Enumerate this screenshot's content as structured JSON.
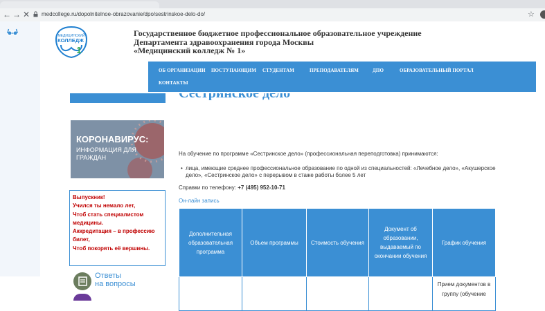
{
  "browser": {
    "url": "medcollege.ru/dopolnitelnoe-obrazovanie/dpo/sestrinskoe-delo-do/"
  },
  "header": {
    "logo_lines": [
      "МЕДИЦИНСКИЙ",
      "КОЛЛЕДЖ",
      "1"
    ],
    "institution": [
      "Государственное бюджетное профессиональное образовательное учреждение",
      "Департамента здравоохранения города Москвы",
      "«Медицинский колледж № 1»"
    ]
  },
  "menu": {
    "items": [
      "ОБ ОРГАНИЗАЦИИ",
      "ПОСТУПАЮЩИМ",
      "СТУДЕНТАМ",
      "ПРЕПОДАВАТЕЛЯМ",
      "ДПО",
      "ОБРАЗОВАТЕЛЬНЫЙ ПОРТАЛ",
      "КОНТАКТЫ"
    ]
  },
  "page": {
    "heading": "Сестринское дело",
    "intro": "На обучение по программе «Сестринское дело» (профессиональная переподготовка) принимаются:",
    "bullet": "лица, имеющие среднее профессиональное образование по одной из специальностей: «Лечебное дело», «Акушерское дело», «Сестринское дело» с перерывом в стаже работы более 5 лет",
    "phone_label": "Справки по телефону: ",
    "phone": "+7 (495) 952-10-71",
    "online_link": "Он-лайн запись"
  },
  "sidebar": {
    "covid_title": "КОРОНАВИРУС:",
    "covid_sub": "ИНФОРМАЦИЯ ДЛЯ ГРАЖДАН",
    "notice_lines": [
      "Выпускник!",
      "Учился ты немало лет,",
      "Чтоб стать специалистом",
      "медицины.",
      "Аккредитация – в профессию",
      "билет,",
      "Чтоб покорять её вершины."
    ],
    "faq_line1": "Ответы",
    "faq_line2": "на вопросы"
  },
  "table": {
    "headers": [
      "Дополнительная образовательная программа",
      "Объем программы",
      "Стоимость обучения",
      "Документ об образовании, выдаваемый по окончании обучения",
      "График обучения"
    ],
    "rows": [
      [
        "",
        "",
        "",
        "",
        "Прием документов в группу (обучение"
      ]
    ]
  },
  "colors": {
    "accent": "#3b8fd4",
    "notice_text": "#c00000"
  }
}
